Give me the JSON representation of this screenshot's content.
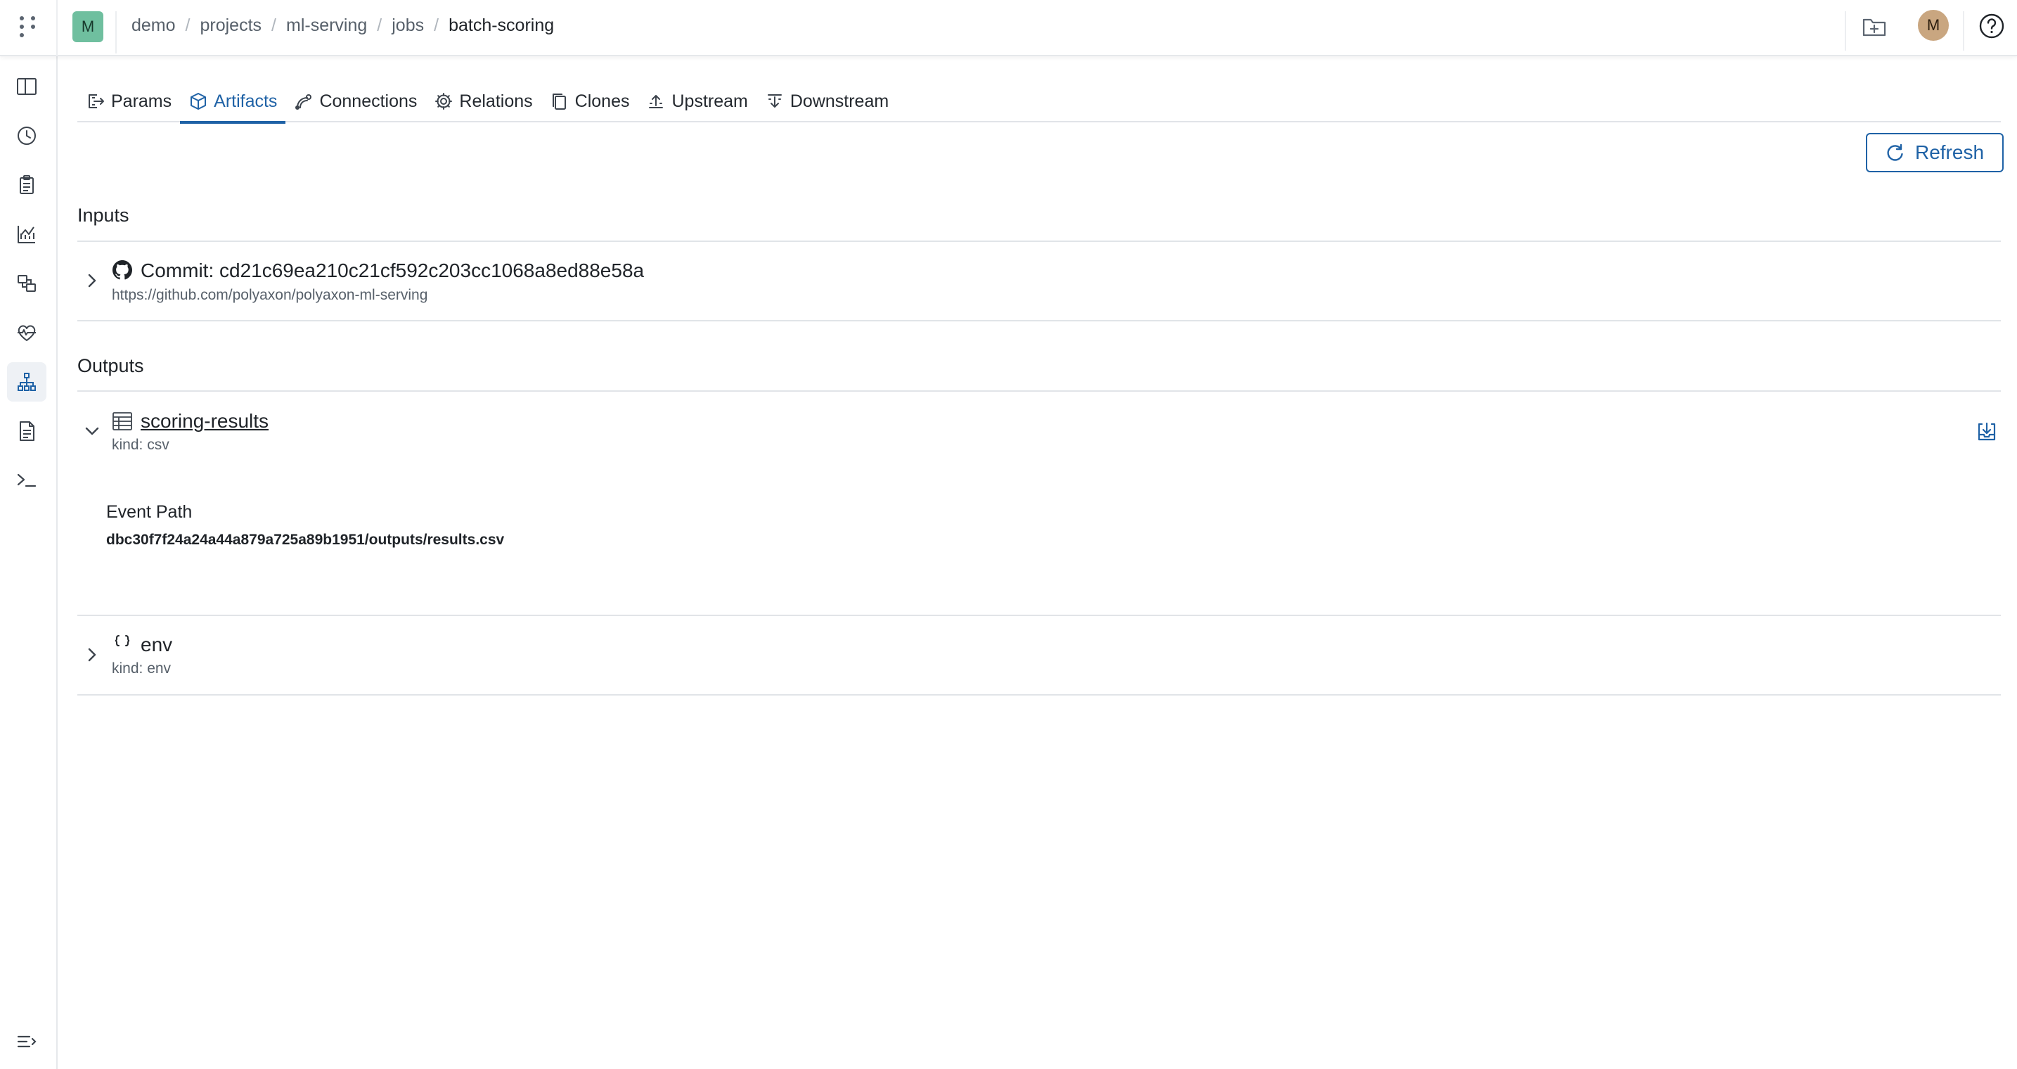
{
  "header": {
    "org_avatar": "M",
    "user_avatar": "M",
    "breadcrumb": [
      "demo",
      "projects",
      "ml-serving",
      "jobs"
    ],
    "current": "batch-scoring"
  },
  "tabs": [
    {
      "label": "Params",
      "icon": "params-icon"
    },
    {
      "label": "Artifacts",
      "icon": "artifacts-icon",
      "active": true
    },
    {
      "label": "Connections",
      "icon": "connections-icon"
    },
    {
      "label": "Relations",
      "icon": "gear-icon"
    },
    {
      "label": "Clones",
      "icon": "clones-icon"
    },
    {
      "label": "Upstream",
      "icon": "upstream-icon"
    },
    {
      "label": "Downstream",
      "icon": "downstream-icon"
    }
  ],
  "toolbar": {
    "refresh_label": "Refresh"
  },
  "inputs": {
    "title": "Inputs",
    "items": [
      {
        "title": "Commit: cd21c69ea210c21cf592c203cc1068a8ed88e58a",
        "subtitle": "https://github.com/polyaxon/polyaxon-ml-serving",
        "icon": "github-icon"
      }
    ]
  },
  "outputs": {
    "title": "Outputs",
    "items": [
      {
        "title": "scoring-results",
        "subtitle": "kind: csv",
        "icon": "table-icon",
        "expanded": true,
        "detail_label": "Event Path",
        "detail_value": "dbc30f7f24a24a44a879a725a89b1951/outputs/results.csv"
      },
      {
        "title": "env",
        "subtitle": "kind: env",
        "icon": "braces-icon"
      }
    ]
  },
  "sidebar": [
    "panel-icon",
    "clock-icon",
    "clipboard-icon",
    "chart-icon",
    "artifacts-icon",
    "heartbeat-icon",
    "lineage-icon",
    "document-icon",
    "terminal-icon"
  ],
  "colors": {
    "accent": "#1f62a6",
    "org_avatar": "#6fbf9f",
    "user_avatar": "#c9a680"
  }
}
